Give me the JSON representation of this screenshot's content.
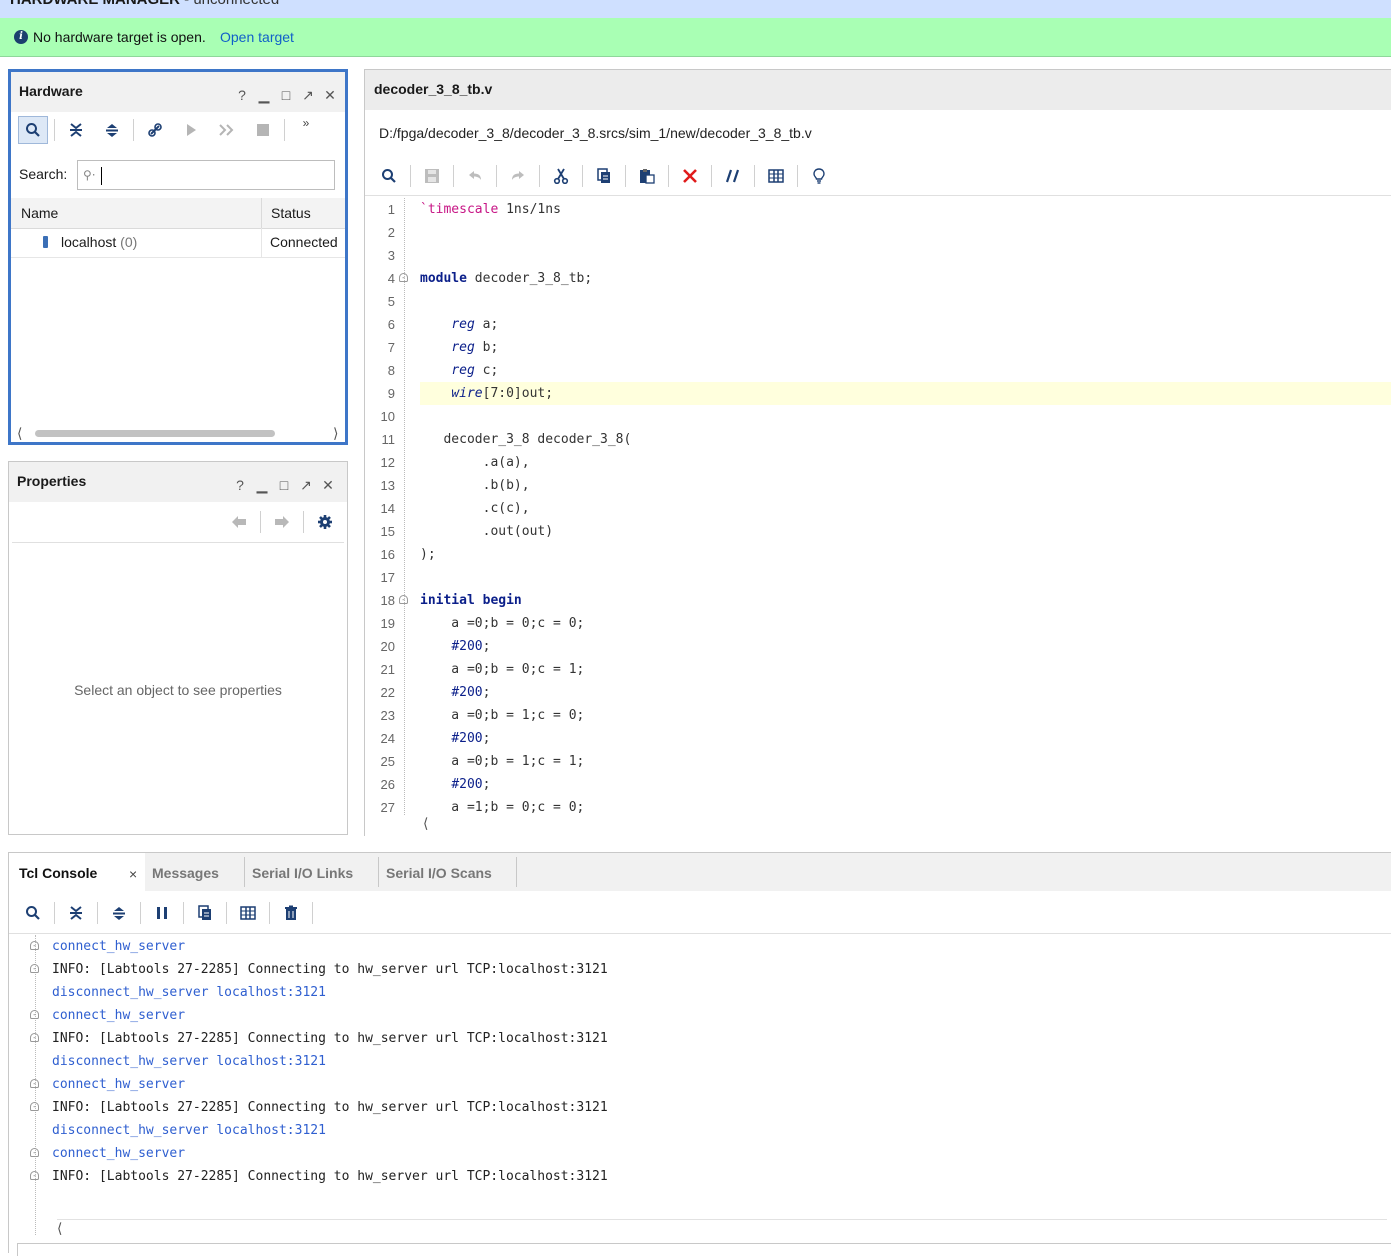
{
  "title_bar": {
    "title": "HARDWARE MANAGER",
    "subtitle": " - unconnected"
  },
  "banner": {
    "message": "No hardware target is open.",
    "link": "Open target"
  },
  "hardware_panel": {
    "title": "Hardware",
    "search_label": "Search:",
    "columns": [
      "Name",
      "Status"
    ],
    "rows": [
      {
        "name": "localhost",
        "count": "(0)",
        "status": "Connected"
      }
    ]
  },
  "properties_panel": {
    "title": "Properties",
    "empty_text": "Select an object to see properties"
  },
  "editor": {
    "tab": "decoder_3_8_tb.v",
    "path": "D:/fpga/decoder_3_8/decoder_3_8.srcs/sim_1/new/decoder_3_8_tb.v",
    "line_numbers": [
      "1",
      "2",
      "3",
      "4",
      "5",
      "6",
      "7",
      "8",
      "9",
      "10",
      "11",
      "12",
      "13",
      "14",
      "15",
      "16",
      "17",
      "18",
      "19",
      "20",
      "21",
      "22",
      "23",
      "24",
      "25",
      "26",
      "27"
    ]
  },
  "console": {
    "tabs": [
      "Tcl Console",
      "Messages",
      "Serial I/O Links",
      "Serial I/O Scans"
    ],
    "close_glyph": "×",
    "lines": [
      "connect_hw_server",
      "INFO: [Labtools 27-2285] Connecting to hw_server url TCP:localhost:3121",
      "disconnect_hw_server localhost:3121",
      "connect_hw_server",
      "INFO: [Labtools 27-2285] Connecting to hw_server url TCP:localhost:3121",
      "disconnect_hw_server localhost:3121",
      "connect_hw_server",
      "INFO: [Labtools 27-2285] Connecting to hw_server url TCP:localhost:3121",
      "disconnect_hw_server localhost:3121",
      "connect_hw_server",
      "INFO: [Labtools 27-2285] Connecting to hw_server url TCP:localhost:3121"
    ]
  },
  "colors": {
    "accent": "#3e76c8",
    "banner": "#a9ffb4",
    "title_bar": "#cfe0ff",
    "command": "#2f5fd0",
    "highlight_line": "#ffffdd"
  },
  "icons": [
    "info-icon",
    "search-icon",
    "collapse-all-icon",
    "expand-all-icon",
    "auto-connect-icon",
    "play-icon",
    "fast-forward-icon",
    "stop-icon",
    "more-icon",
    "help-icon",
    "minimize-icon",
    "maximize-icon",
    "float-icon",
    "close-icon",
    "back-icon",
    "forward-icon",
    "gear-icon",
    "save-icon",
    "undo-icon",
    "redo-icon",
    "cut-icon",
    "copy-icon",
    "paste-icon",
    "delete-icon",
    "comment-icon",
    "columns-icon",
    "bulb-icon",
    "pause-icon",
    "clear-icon",
    "server-icon"
  ]
}
